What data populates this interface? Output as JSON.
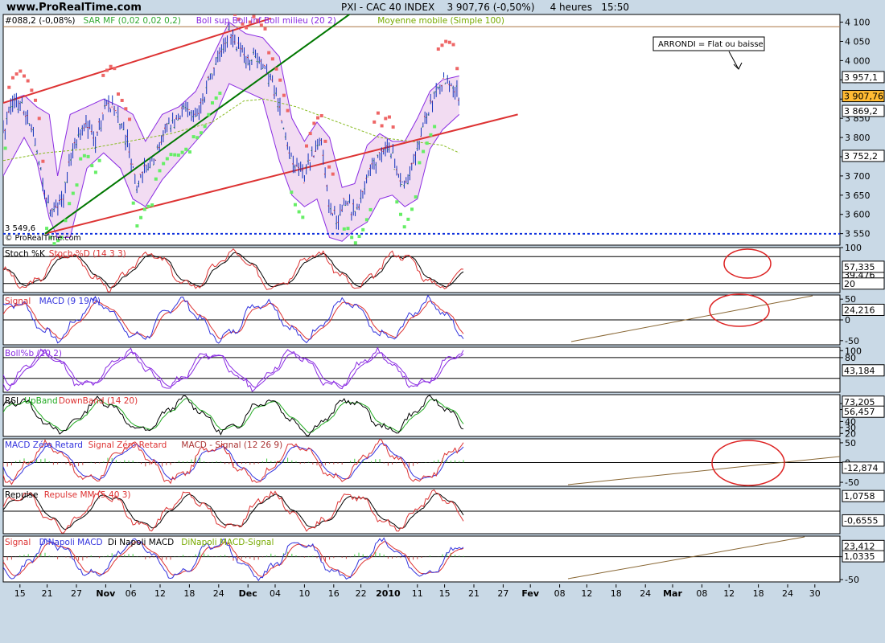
{
  "header": {
    "site": "www.ProRealTime.com",
    "symbol": "PXI - CAC 40 INDEX",
    "price": "3 907,76 (-0,50%)",
    "interval": "4 heures",
    "time": "15:50"
  },
  "watermark": "© ProRealTime.com",
  "annotation": "ARRONDI = Flat ou baisse",
  "colors": {
    "background": "#c9d9e6",
    "panel": "#ffffff",
    "band_fill": "#f2dcf2",
    "boll": "#8a2be2",
    "sar_up": "#66ee66",
    "sar_down": "#ee6666",
    "trend_red": "#dd3333",
    "trend_green": "#007700",
    "candles": "#1133bb"
  },
  "chart_data": [
    {
      "type": "candlestick",
      "panel": "price",
      "legend": [
        {
          "text": "#088,2 (-0,08%)",
          "color": "#000000"
        },
        {
          "text": "SAR MF (0,02 0,02 0,2)",
          "color": "#33aa33"
        },
        {
          "text": "Boll sup Boll inf Boll milieu (20 2)",
          "color": "#8a2be2"
        },
        {
          "text": "Moyenne mobile (Simple 100)",
          "color": "#77aa00"
        }
      ],
      "ylim": [
        3520,
        4120
      ],
      "y_ticks": [
        "4 100",
        "4 050",
        "4 000",
        "3 950",
        "3 900",
        "3 850",
        "3 800",
        "3 750",
        "3 700",
        "3 650",
        "3 600",
        "3 550"
      ],
      "tick_values": [
        4100,
        4050,
        4000,
        3950,
        3900,
        3850,
        3800,
        3750,
        3700,
        3650,
        3600,
        3550
      ],
      "value_labels": [
        {
          "text": "3 957,1",
          "value": 3957.1
        },
        {
          "text": "3 907,76",
          "value": 3907.76,
          "highlight": true
        },
        {
          "text": "3 869,2",
          "value": 3869.2
        },
        {
          "text": "3 752,2",
          "value": 3752.2
        }
      ],
      "support_label": "3 549,6",
      "support_value": 3549.6,
      "resistance_value": 4088,
      "price_path": [
        [
          0,
          3820
        ],
        [
          4,
          3880
        ],
        [
          8,
          3890
        ],
        [
          12,
          3850
        ],
        [
          16,
          3780
        ],
        [
          20,
          3640
        ],
        [
          24,
          3600
        ],
        [
          28,
          3630
        ],
        [
          32,
          3740
        ],
        [
          36,
          3800
        ],
        [
          40,
          3830
        ],
        [
          44,
          3790
        ],
        [
          48,
          3870
        ],
        [
          52,
          3880
        ],
        [
          56,
          3840
        ],
        [
          60,
          3780
        ],
        [
          64,
          3660
        ],
        [
          68,
          3720
        ],
        [
          72,
          3740
        ],
        [
          76,
          3800
        ],
        [
          80,
          3840
        ],
        [
          84,
          3850
        ],
        [
          88,
          3880
        ],
        [
          92,
          3860
        ],
        [
          96,
          3900
        ],
        [
          100,
          3980
        ],
        [
          104,
          4020
        ],
        [
          108,
          4080
        ],
        [
          112,
          4040
        ],
        [
          116,
          4000
        ],
        [
          120,
          4020
        ],
        [
          124,
          3980
        ],
        [
          128,
          3950
        ],
        [
          132,
          3880
        ],
        [
          136,
          3780
        ],
        [
          140,
          3720
        ],
        [
          144,
          3700
        ],
        [
          148,
          3760
        ],
        [
          152,
          3780
        ],
        [
          156,
          3620
        ],
        [
          160,
          3580
        ],
        [
          164,
          3640
        ],
        [
          168,
          3600
        ],
        [
          172,
          3650
        ],
        [
          176,
          3720
        ],
        [
          180,
          3760
        ],
        [
          184,
          3790
        ],
        [
          188,
          3720
        ],
        [
          192,
          3660
        ],
        [
          196,
          3730
        ],
        [
          200,
          3820
        ],
        [
          204,
          3880
        ],
        [
          208,
          3940
        ],
        [
          212,
          3950
        ],
        [
          216,
          3925
        ],
        [
          218,
          3907.76
        ]
      ],
      "boll_upper": [
        [
          0,
          3890
        ],
        [
          10,
          3910
        ],
        [
          16,
          3880
        ],
        [
          22,
          3860
        ],
        [
          26,
          3700
        ],
        [
          32,
          3860
        ],
        [
          40,
          3880
        ],
        [
          48,
          3900
        ],
        [
          56,
          3880
        ],
        [
          62,
          3860
        ],
        [
          68,
          3790
        ],
        [
          76,
          3860
        ],
        [
          84,
          3880
        ],
        [
          92,
          3920
        ],
        [
          100,
          4010
        ],
        [
          108,
          4100
        ],
        [
          116,
          4070
        ],
        [
          124,
          4060
        ],
        [
          132,
          4010
        ],
        [
          138,
          3850
        ],
        [
          144,
          3790
        ],
        [
          150,
          3840
        ],
        [
          156,
          3800
        ],
        [
          162,
          3670
        ],
        [
          168,
          3680
        ],
        [
          174,
          3780
        ],
        [
          180,
          3810
        ],
        [
          186,
          3790
        ],
        [
          192,
          3790
        ],
        [
          198,
          3850
        ],
        [
          204,
          3920
        ],
        [
          210,
          3950
        ],
        [
          218,
          3960
        ]
      ],
      "boll_lower": [
        [
          0,
          3700
        ],
        [
          10,
          3800
        ],
        [
          16,
          3740
        ],
        [
          22,
          3590
        ],
        [
          26,
          3540
        ],
        [
          32,
          3540
        ],
        [
          40,
          3720
        ],
        [
          48,
          3760
        ],
        [
          56,
          3720
        ],
        [
          62,
          3640
        ],
        [
          68,
          3620
        ],
        [
          76,
          3690
        ],
        [
          84,
          3740
        ],
        [
          92,
          3790
        ],
        [
          100,
          3840
        ],
        [
          108,
          3940
        ],
        [
          116,
          3920
        ],
        [
          124,
          3900
        ],
        [
          132,
          3740
        ],
        [
          138,
          3650
        ],
        [
          144,
          3620
        ],
        [
          150,
          3640
        ],
        [
          156,
          3540
        ],
        [
          162,
          3530
        ],
        [
          168,
          3560
        ],
        [
          174,
          3580
        ],
        [
          180,
          3640
        ],
        [
          186,
          3650
        ],
        [
          192,
          3620
        ],
        [
          198,
          3640
        ],
        [
          204,
          3770
        ],
        [
          210,
          3820
        ],
        [
          218,
          3860
        ]
      ],
      "sma100": [
        [
          0,
          3740
        ],
        [
          20,
          3760
        ],
        [
          40,
          3770
        ],
        [
          60,
          3790
        ],
        [
          80,
          3810
        ],
        [
          100,
          3840
        ],
        [
          115,
          3895
        ],
        [
          125,
          3900
        ],
        [
          140,
          3880
        ],
        [
          160,
          3840
        ],
        [
          180,
          3800
        ],
        [
          195,
          3790
        ],
        [
          210,
          3780
        ],
        [
          218,
          3760
        ]
      ],
      "trendlines": [
        {
          "color": "trend_red",
          "x1": 0,
          "y1": 3890,
          "x2": 128,
          "y2": 4110
        },
        {
          "color": "trend_red",
          "x1": 20,
          "y1": 3550,
          "x2": 246,
          "y2": 3860
        },
        {
          "color": "trend_green",
          "x1": 20,
          "y1": 3550,
          "x2": 168,
          "y2": 4130
        }
      ]
    },
    {
      "type": "line",
      "panel": "stoch",
      "legend": [
        {
          "text": "Stoch %K",
          "color": "#000000"
        },
        {
          "text": "Stoch %D (14 3 3)",
          "color": "#dd3333"
        }
      ],
      "ylim": [
        0,
        100
      ],
      "y_ticks": [
        "100"
      ],
      "tick_values": [
        100
      ],
      "value_labels": [
        {
          "text": "39,476",
          "value": 39.476
        },
        {
          "text": "57,335",
          "value": 57.335
        },
        {
          "text": "20",
          "value": 20
        }
      ],
      "ref_lines": [
        80,
        20
      ],
      "seed": 3
    },
    {
      "type": "line",
      "panel": "macd",
      "legend": [
        {
          "text": "Signal",
          "color": "#dd3333"
        },
        {
          "text": "MACD (9 19 6)",
          "color": "#3333dd"
        }
      ],
      "ylim": [
        -60,
        60
      ],
      "y_ticks": [
        "50",
        "0",
        "-50"
      ],
      "tick_values": [
        50,
        0,
        -50
      ],
      "value_labels": [
        {
          "text": "24,216",
          "value": 24.216
        }
      ],
      "ref_lines": [
        0
      ],
      "seed": 7
    },
    {
      "type": "line",
      "panel": "boll_pct",
      "legend": [
        {
          "text": "Boll%b (20 2)",
          "color": "#8a2be2"
        }
      ],
      "ylim": [
        -20,
        110
      ],
      "y_ticks": [
        "100",
        "80"
      ],
      "tick_values": [
        100,
        80
      ],
      "value_labels": [
        {
          "text": "43,184",
          "value": 43.184
        }
      ],
      "ref_lines": [
        80,
        20
      ],
      "seed": 11
    },
    {
      "type": "line",
      "panel": "rsi",
      "legend": [
        {
          "text": "RSI",
          "color": "#000000"
        },
        {
          "text": "UpBand",
          "color": "#22aa22"
        },
        {
          "text": "DownBand (14 20)",
          "color": "#dd3333"
        }
      ],
      "ylim": [
        15,
        85
      ],
      "y_ticks": [
        "70",
        "60",
        "40",
        "30",
        "20"
      ],
      "tick_values": [
        70,
        60,
        40,
        30,
        20
      ],
      "value_labels": [
        {
          "text": "73,205",
          "value": 73.205
        },
        {
          "text": "56,457",
          "value": 56.457
        }
      ],
      "ref_lines": [],
      "seed": 13
    },
    {
      "type": "line",
      "panel": "macd_zero",
      "legend": [
        {
          "text": "MACD Zéro Retard",
          "color": "#3333dd"
        },
        {
          "text": "Signal Zéro Retard",
          "color": "#dd3333"
        },
        {
          "text": "MACD - Signal (12 26 9)",
          "color": "#aa3333"
        }
      ],
      "ylim": [
        -60,
        60
      ],
      "y_ticks": [
        "50",
        "0",
        "-50"
      ],
      "tick_values": [
        50,
        0,
        -50
      ],
      "value_labels": [
        {
          "text": "-12,874",
          "value": -12.874
        }
      ],
      "ref_lines": [
        0
      ],
      "seed": 17
    },
    {
      "type": "line",
      "panel": "repulse",
      "legend": [
        {
          "text": "Repulse",
          "color": "#000000"
        },
        {
          "text": "Repulse MM (5 40 3)",
          "color": "#dd3333"
        }
      ],
      "ylim": [
        -1.6,
        1.6
      ],
      "y_ticks": [],
      "tick_values": [],
      "value_labels": [
        {
          "text": "1,0758",
          "value": 1.0758
        },
        {
          "text": "-0,6555",
          "value": -0.6555
        }
      ],
      "ref_lines": [
        0
      ],
      "seed": 19
    },
    {
      "type": "line",
      "panel": "dinapoli",
      "legend": [
        {
          "text": "Signal",
          "color": "#dd3333"
        },
        {
          "text": "DiNapoli MACD",
          "color": "#3333dd"
        },
        {
          "text": "Di Napoli MACD",
          "color": "#000000"
        },
        {
          "text": "DiNapoli MACD-Signal",
          "color": "#77aa00"
        }
      ],
      "ylim": [
        -55,
        45
      ],
      "y_ticks": [
        "0",
        "-50"
      ],
      "tick_values": [
        0,
        -50
      ],
      "value_labels": [
        {
          "text": "23,412",
          "value": 23.412
        },
        {
          "text": "1,0335",
          "value": 1.0335
        }
      ],
      "ref_lines": [
        0
      ],
      "seed": 23
    }
  ],
  "x_axis": [
    {
      "label": "15",
      "bold": false
    },
    {
      "label": "21",
      "bold": false
    },
    {
      "label": "27",
      "bold": false
    },
    {
      "label": "Nov",
      "bold": true
    },
    {
      "label": "06",
      "bold": false
    },
    {
      "label": "12",
      "bold": false
    },
    {
      "label": "18",
      "bold": false
    },
    {
      "label": "24",
      "bold": false
    },
    {
      "label": "Dec",
      "bold": true
    },
    {
      "label": "04",
      "bold": false
    },
    {
      "label": "10",
      "bold": false
    },
    {
      "label": "16",
      "bold": false
    },
    {
      "label": "22",
      "bold": false
    },
    {
      "label": "2010",
      "bold": true
    },
    {
      "label": "11",
      "bold": false
    },
    {
      "label": "15",
      "bold": false
    },
    {
      "label": "21",
      "bold": false
    },
    {
      "label": "27",
      "bold": false
    },
    {
      "label": "Fev",
      "bold": true
    },
    {
      "label": "08",
      "bold": false
    },
    {
      "label": "12",
      "bold": false
    },
    {
      "label": "18",
      "bold": false
    },
    {
      "label": "24",
      "bold": false
    },
    {
      "label": "Mar",
      "bold": true
    },
    {
      "label": "08",
      "bold": false
    },
    {
      "label": "12",
      "bold": false
    },
    {
      "label": "18",
      "bold": false
    },
    {
      "label": "24",
      "bold": false
    },
    {
      "label": "30",
      "bold": false
    }
  ],
  "x_ticks_pos": [
    8,
    21,
    35,
    49,
    61,
    75,
    89,
    103,
    117,
    130,
    144,
    158,
    171,
    184,
    198,
    211,
    225,
    239,
    252,
    266,
    279,
    293,
    307,
    320,
    334,
    347,
    361,
    375,
    388
  ]
}
